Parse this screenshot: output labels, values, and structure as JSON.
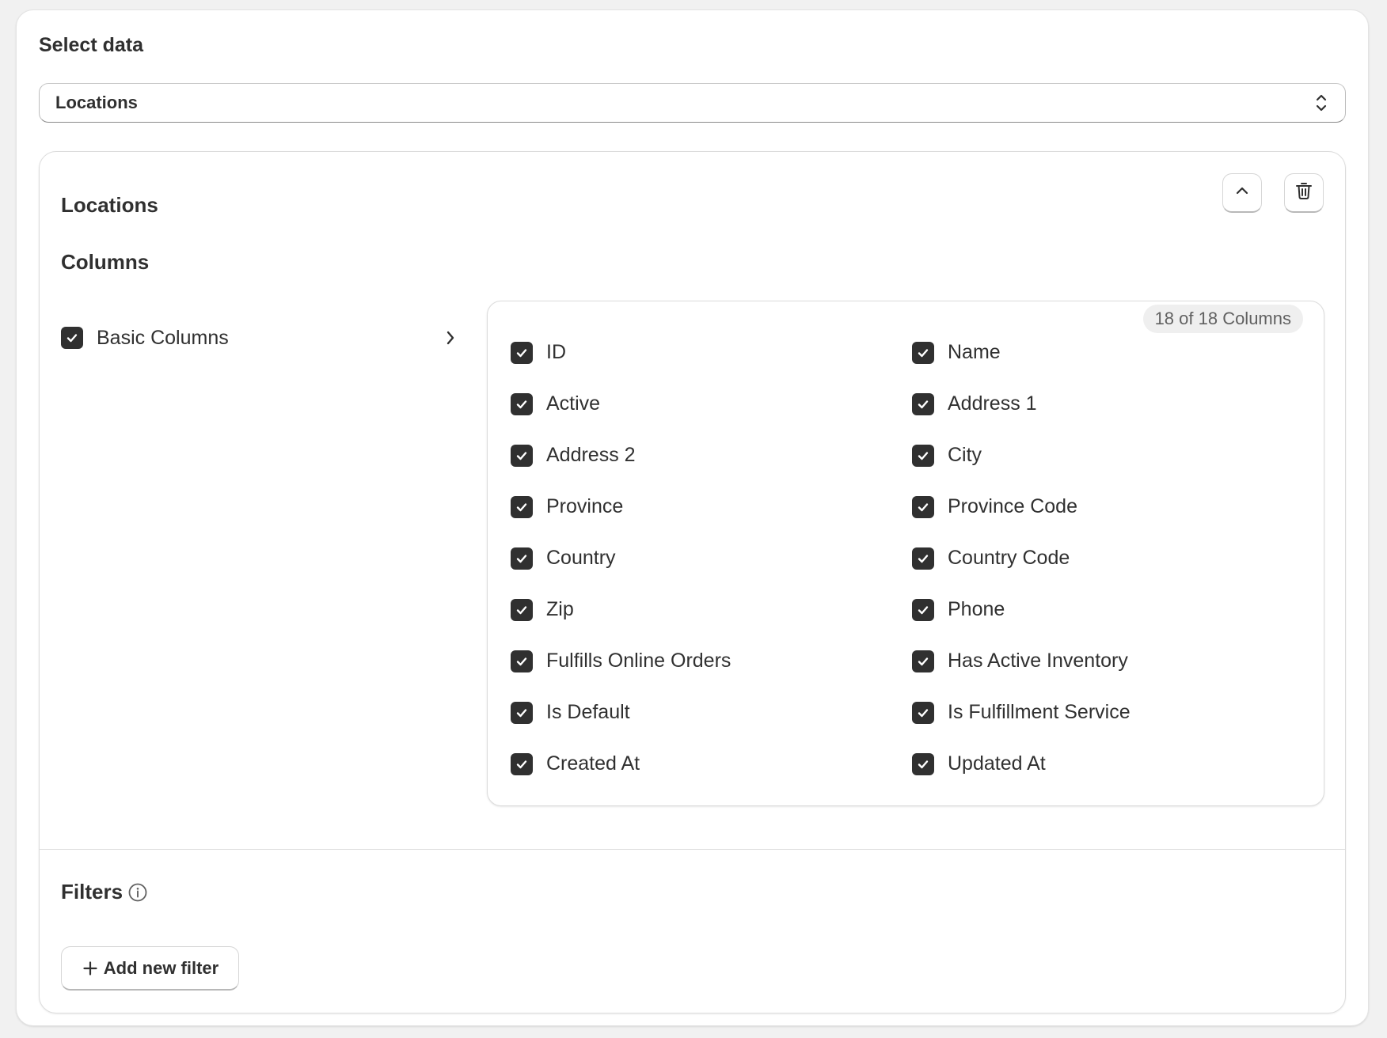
{
  "select_data": {
    "title": "Select data",
    "selected": "Locations"
  },
  "dataset": {
    "title": "Locations",
    "collapse_icon": "chevron-up-icon",
    "delete_icon": "trash-icon"
  },
  "columns": {
    "heading": "Columns",
    "group": {
      "label": "Basic Columns",
      "checked": true
    },
    "count_badge": "18 of 18 Columns",
    "items": [
      {
        "label": "ID",
        "checked": true
      },
      {
        "label": "Name",
        "checked": true
      },
      {
        "label": "Active",
        "checked": true
      },
      {
        "label": "Address 1",
        "checked": true
      },
      {
        "label": "Address 2",
        "checked": true
      },
      {
        "label": "City",
        "checked": true
      },
      {
        "label": "Province",
        "checked": true
      },
      {
        "label": "Province Code",
        "checked": true
      },
      {
        "label": "Country",
        "checked": true
      },
      {
        "label": "Country Code",
        "checked": true
      },
      {
        "label": "Zip",
        "checked": true
      },
      {
        "label": "Phone",
        "checked": true
      },
      {
        "label": "Fulfills Online Orders",
        "checked": true
      },
      {
        "label": "Has Active Inventory",
        "checked": true
      },
      {
        "label": "Is Default",
        "checked": true
      },
      {
        "label": "Is Fulfillment Service",
        "checked": true
      },
      {
        "label": "Created At",
        "checked": true
      },
      {
        "label": "Updated At",
        "checked": true
      }
    ]
  },
  "filters": {
    "title": "Filters",
    "info_icon": "info-icon",
    "add_button_label": "Add new filter"
  },
  "colors": {
    "checkbox_fill": "#303030",
    "text": "#303030",
    "badge_bg": "#efefef",
    "page_bg": "#f1f1f1"
  }
}
